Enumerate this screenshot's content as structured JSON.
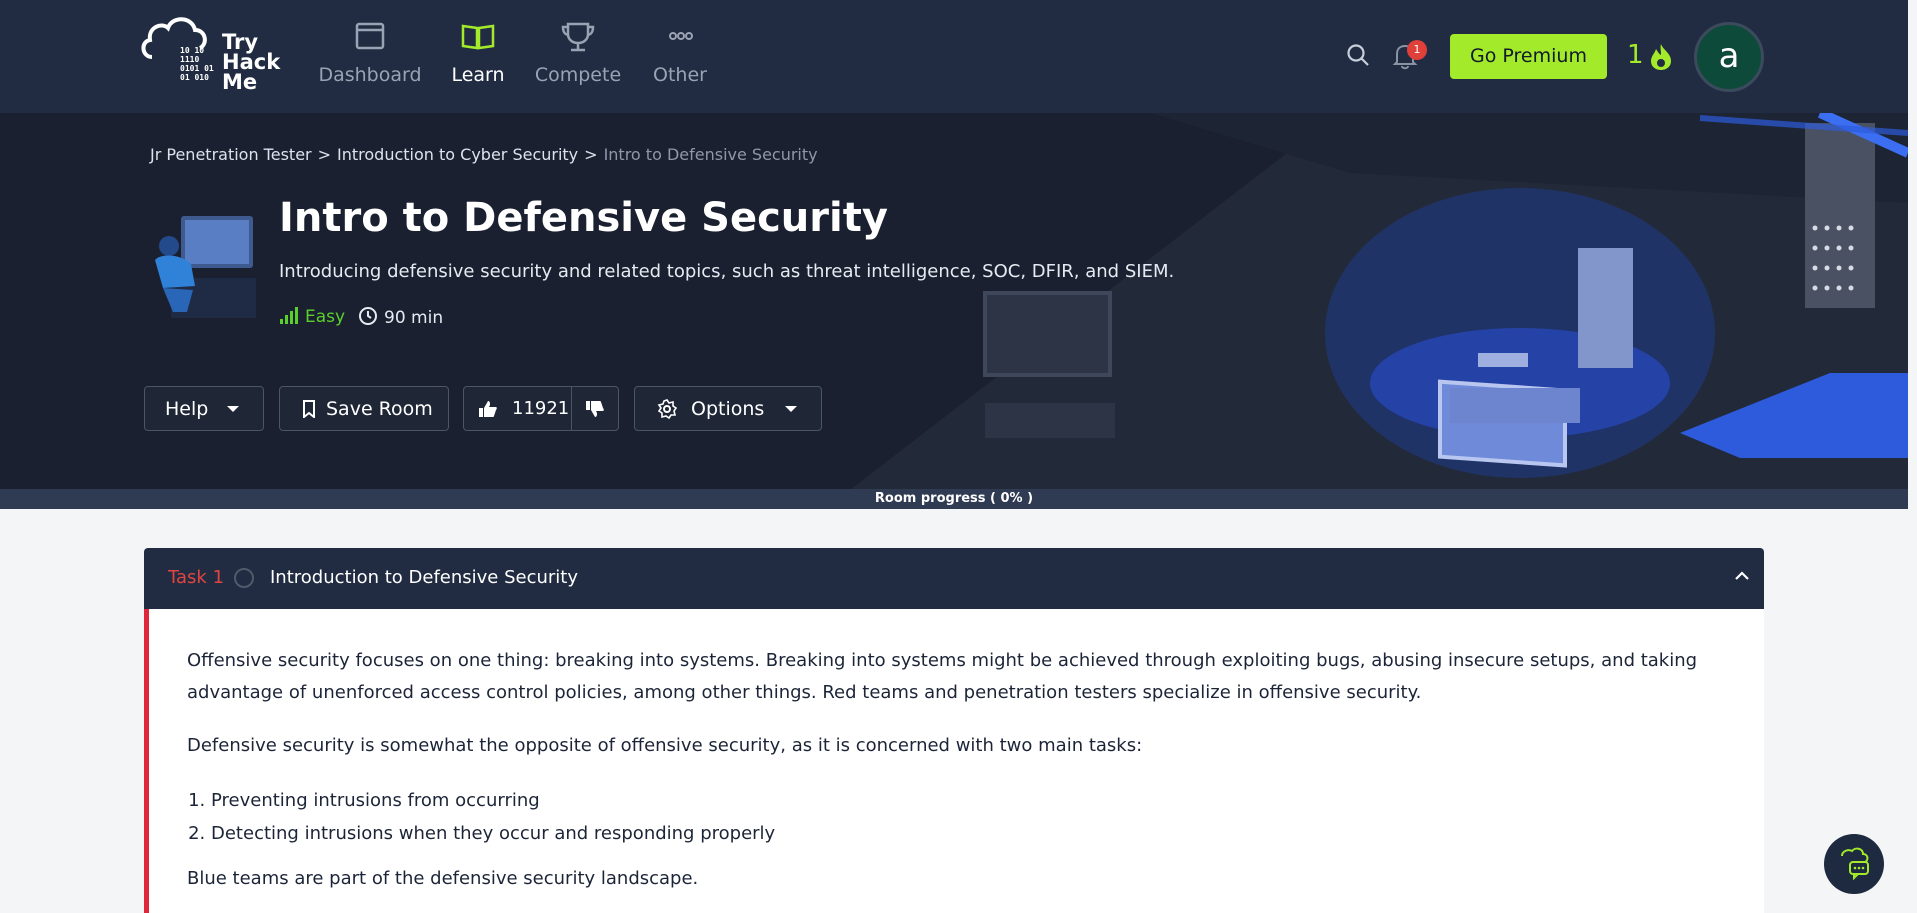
{
  "brand": {
    "logo_text": "Try Hack Me",
    "binary": "10 10\n1110\n0101 01\n01 010"
  },
  "nav": {
    "items": [
      {
        "label": "Dashboard",
        "icon": "window-icon",
        "active": false
      },
      {
        "label": "Learn",
        "icon": "book-icon",
        "active": true
      },
      {
        "label": "Compete",
        "icon": "trophy-icon",
        "active": false
      },
      {
        "label": "Other",
        "icon": "dots-icon",
        "active": false
      }
    ],
    "notifications_count": "1",
    "premium_label": "Go Premium",
    "streak": "1",
    "avatar_letter": "a"
  },
  "breadcrumb": {
    "items": [
      "Jr Penetration Tester",
      "Introduction to Cyber Security",
      "Intro to Defensive Security"
    ],
    "separator": ">"
  },
  "room": {
    "title": "Intro to Defensive Security",
    "description": "Introducing defensive security and related topics, such as threat intelligence, SOC, DFIR, and SIEM.",
    "difficulty": "Easy",
    "duration": "90 min"
  },
  "actions": {
    "help_label": "Help",
    "save_label": "Save Room",
    "likes": "11921",
    "options_label": "Options"
  },
  "progress": {
    "label": "Room progress ( 0% )",
    "value": 0
  },
  "task": {
    "number": "Task 1",
    "title": "Introduction to Defensive Security",
    "paragraph1": "Offensive security focuses on one thing: breaking into systems. Breaking into systems might be achieved through exploiting bugs, abusing insecure setups, and taking advantage of unenforced access control policies, among other things. Red teams and penetration testers specialize in offensive security.",
    "paragraph2": "Defensive security is somewhat the opposite of offensive security, as it is concerned with two main tasks:",
    "list": [
      "Preventing intrusions from occurring",
      "Detecting intrusions when they occur and responding properly"
    ],
    "paragraph3": "Blue teams are part of the defensive security landscape."
  },
  "colors": {
    "nav_bg": "#212c42",
    "accent_green": "#a3ea2a",
    "task_red": "#e0263a",
    "easy_green": "#5bd02c"
  }
}
